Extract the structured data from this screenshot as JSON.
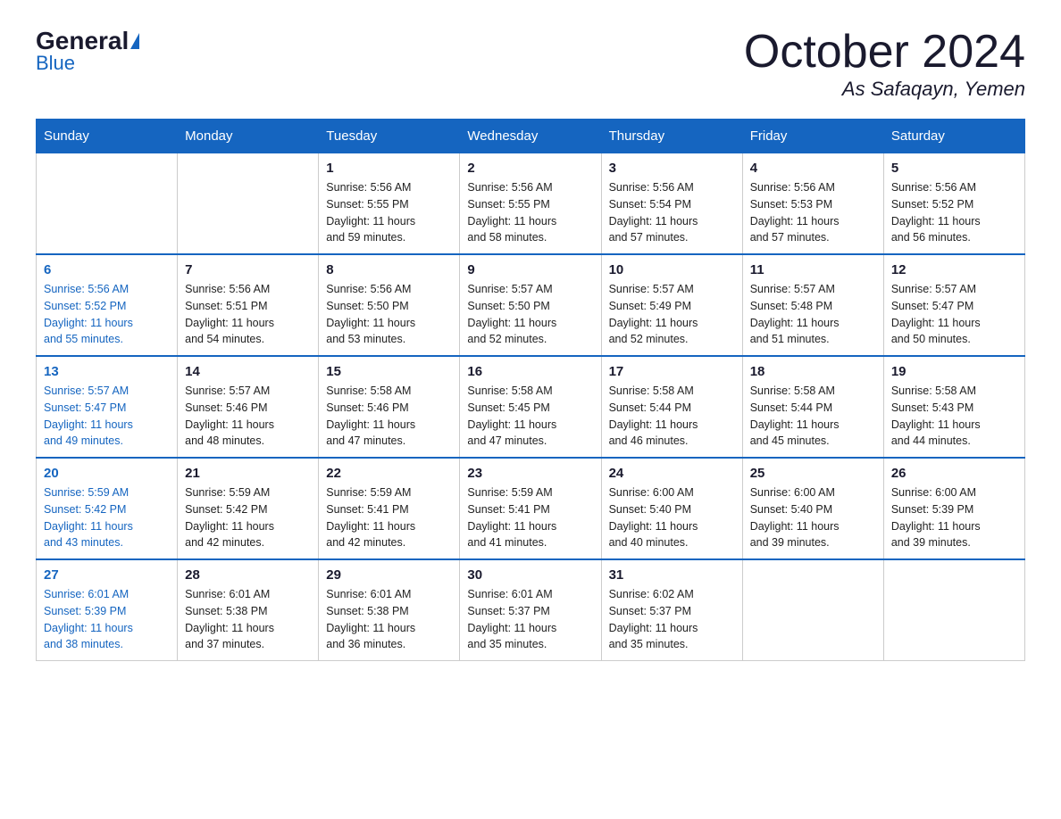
{
  "header": {
    "logo": {
      "general": "General",
      "blue": "Blue"
    },
    "title": "October 2024",
    "location": "As Safaqayn, Yemen"
  },
  "days_of_week": [
    "Sunday",
    "Monday",
    "Tuesday",
    "Wednesday",
    "Thursday",
    "Friday",
    "Saturday"
  ],
  "weeks": [
    [
      {
        "day": "",
        "info": ""
      },
      {
        "day": "",
        "info": ""
      },
      {
        "day": "1",
        "info": "Sunrise: 5:56 AM\nSunset: 5:55 PM\nDaylight: 11 hours\nand 59 minutes."
      },
      {
        "day": "2",
        "info": "Sunrise: 5:56 AM\nSunset: 5:55 PM\nDaylight: 11 hours\nand 58 minutes."
      },
      {
        "day": "3",
        "info": "Sunrise: 5:56 AM\nSunset: 5:54 PM\nDaylight: 11 hours\nand 57 minutes."
      },
      {
        "day": "4",
        "info": "Sunrise: 5:56 AM\nSunset: 5:53 PM\nDaylight: 11 hours\nand 57 minutes."
      },
      {
        "day": "5",
        "info": "Sunrise: 5:56 AM\nSunset: 5:52 PM\nDaylight: 11 hours\nand 56 minutes."
      }
    ],
    [
      {
        "day": "6",
        "info": "Sunrise: 5:56 AM\nSunset: 5:52 PM\nDaylight: 11 hours\nand 55 minutes."
      },
      {
        "day": "7",
        "info": "Sunrise: 5:56 AM\nSunset: 5:51 PM\nDaylight: 11 hours\nand 54 minutes."
      },
      {
        "day": "8",
        "info": "Sunrise: 5:56 AM\nSunset: 5:50 PM\nDaylight: 11 hours\nand 53 minutes."
      },
      {
        "day": "9",
        "info": "Sunrise: 5:57 AM\nSunset: 5:50 PM\nDaylight: 11 hours\nand 52 minutes."
      },
      {
        "day": "10",
        "info": "Sunrise: 5:57 AM\nSunset: 5:49 PM\nDaylight: 11 hours\nand 52 minutes."
      },
      {
        "day": "11",
        "info": "Sunrise: 5:57 AM\nSunset: 5:48 PM\nDaylight: 11 hours\nand 51 minutes."
      },
      {
        "day": "12",
        "info": "Sunrise: 5:57 AM\nSunset: 5:47 PM\nDaylight: 11 hours\nand 50 minutes."
      }
    ],
    [
      {
        "day": "13",
        "info": "Sunrise: 5:57 AM\nSunset: 5:47 PM\nDaylight: 11 hours\nand 49 minutes."
      },
      {
        "day": "14",
        "info": "Sunrise: 5:57 AM\nSunset: 5:46 PM\nDaylight: 11 hours\nand 48 minutes."
      },
      {
        "day": "15",
        "info": "Sunrise: 5:58 AM\nSunset: 5:46 PM\nDaylight: 11 hours\nand 47 minutes."
      },
      {
        "day": "16",
        "info": "Sunrise: 5:58 AM\nSunset: 5:45 PM\nDaylight: 11 hours\nand 47 minutes."
      },
      {
        "day": "17",
        "info": "Sunrise: 5:58 AM\nSunset: 5:44 PM\nDaylight: 11 hours\nand 46 minutes."
      },
      {
        "day": "18",
        "info": "Sunrise: 5:58 AM\nSunset: 5:44 PM\nDaylight: 11 hours\nand 45 minutes."
      },
      {
        "day": "19",
        "info": "Sunrise: 5:58 AM\nSunset: 5:43 PM\nDaylight: 11 hours\nand 44 minutes."
      }
    ],
    [
      {
        "day": "20",
        "info": "Sunrise: 5:59 AM\nSunset: 5:42 PM\nDaylight: 11 hours\nand 43 minutes."
      },
      {
        "day": "21",
        "info": "Sunrise: 5:59 AM\nSunset: 5:42 PM\nDaylight: 11 hours\nand 42 minutes."
      },
      {
        "day": "22",
        "info": "Sunrise: 5:59 AM\nSunset: 5:41 PM\nDaylight: 11 hours\nand 42 minutes."
      },
      {
        "day": "23",
        "info": "Sunrise: 5:59 AM\nSunset: 5:41 PM\nDaylight: 11 hours\nand 41 minutes."
      },
      {
        "day": "24",
        "info": "Sunrise: 6:00 AM\nSunset: 5:40 PM\nDaylight: 11 hours\nand 40 minutes."
      },
      {
        "day": "25",
        "info": "Sunrise: 6:00 AM\nSunset: 5:40 PM\nDaylight: 11 hours\nand 39 minutes."
      },
      {
        "day": "26",
        "info": "Sunrise: 6:00 AM\nSunset: 5:39 PM\nDaylight: 11 hours\nand 39 minutes."
      }
    ],
    [
      {
        "day": "27",
        "info": "Sunrise: 6:01 AM\nSunset: 5:39 PM\nDaylight: 11 hours\nand 38 minutes."
      },
      {
        "day": "28",
        "info": "Sunrise: 6:01 AM\nSunset: 5:38 PM\nDaylight: 11 hours\nand 37 minutes."
      },
      {
        "day": "29",
        "info": "Sunrise: 6:01 AM\nSunset: 5:38 PM\nDaylight: 11 hours\nand 36 minutes."
      },
      {
        "day": "30",
        "info": "Sunrise: 6:01 AM\nSunset: 5:37 PM\nDaylight: 11 hours\nand 35 minutes."
      },
      {
        "day": "31",
        "info": "Sunrise: 6:02 AM\nSunset: 5:37 PM\nDaylight: 11 hours\nand 35 minutes."
      },
      {
        "day": "",
        "info": ""
      },
      {
        "day": "",
        "info": ""
      }
    ]
  ]
}
